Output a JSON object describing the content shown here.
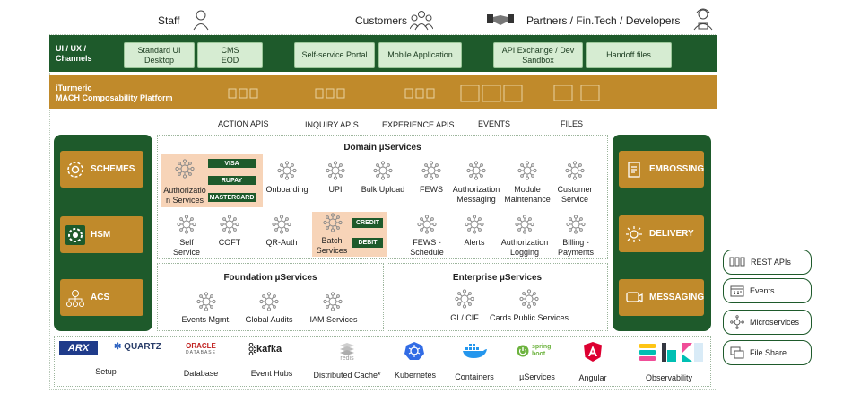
{
  "header": {
    "staff": "Staff",
    "customers": "Customers",
    "partners": "Partners / Fin.Tech / Developers"
  },
  "channels": {
    "title_line1": "UI / UX /",
    "title_line2": "Channels",
    "buttons": [
      {
        "l1": "Standard UI",
        "l2": "Desktop"
      },
      {
        "l1": "CMS",
        "l2": "EOD"
      },
      {
        "l1": "Self-service Portal",
        "l2": ""
      },
      {
        "l1": "Mobile Application",
        "l2": ""
      },
      {
        "l1": "API Exchange / Dev",
        "l2": "Sandbox"
      },
      {
        "l1": "Handoff files",
        "l2": ""
      }
    ]
  },
  "platform": {
    "line1": "iTurmeric",
    "line2": "MACH Composability Platform"
  },
  "apis": [
    "ACTION APIS",
    "INQUIRY APIS",
    "EXPERIENCE APIS",
    "EVENTS",
    "FILES"
  ],
  "left_column": [
    "SCHEMES",
    "HSM",
    "ACS"
  ],
  "right_column": [
    "EMBOSSING",
    "DELIVERY",
    "MESSAGING"
  ],
  "domain": {
    "title": "Domain µServices",
    "auth": {
      "l1": "Authorizatio",
      "l2": "n Services",
      "tags": [
        "VISA",
        "RUPAY",
        "MASTERCARD"
      ]
    },
    "row1": [
      {
        "l1": "Onboarding",
        "l2": ""
      },
      {
        "l1": "UPI",
        "l2": ""
      },
      {
        "l1": "Bulk Upload",
        "l2": ""
      },
      {
        "l1": "FEWS",
        "l2": ""
      },
      {
        "l1": "Authorization",
        "l2": "Messaging"
      },
      {
        "l1": "Module",
        "l2": "Maintenance"
      },
      {
        "l1": "Customer",
        "l2": "Service"
      }
    ],
    "row2a": [
      {
        "l1": "Self",
        "l2": "Service"
      },
      {
        "l1": "COFT",
        "l2": ""
      },
      {
        "l1": "QR-Auth",
        "l2": ""
      }
    ],
    "batch": {
      "l1": "Batch",
      "l2": "Services",
      "tags": [
        "CREDIT",
        "DEBIT"
      ]
    },
    "row2b": [
      {
        "l1": "FEWS -",
        "l2": "Schedule"
      },
      {
        "l1": "Alerts",
        "l2": ""
      },
      {
        "l1": "Authorization",
        "l2": "Logging"
      },
      {
        "l1": "Billing -",
        "l2": "Payments"
      }
    ]
  },
  "foundation": {
    "title": "Foundation µServices",
    "items": [
      "Events Mgmt.",
      "Global Audits",
      "IAM Services"
    ]
  },
  "enterprise": {
    "title": "Enterprise µServices",
    "items": [
      "GL/ CIF",
      "Cards Public Services"
    ]
  },
  "bottom": {
    "setup": "Setup",
    "arx": "ARX",
    "quartz": "QUARTZ",
    "database": "Database",
    "oracle_l1": "ORACLE",
    "oracle_l2": "DATABASE",
    "event_hubs": "Event Hubs",
    "kafka": "kafka",
    "cache": "Distributed Cache*",
    "redis": "redis",
    "kubernetes": "Kubernetes",
    "containers": "Containers",
    "microservices": "µServices",
    "spring_l1": "spring",
    "spring_l2": "boot",
    "angular": "Angular",
    "observability": "Observability"
  },
  "legend": [
    "REST APIs",
    "Events",
    "Microservices",
    "File Share"
  ],
  "colors": {
    "green": "#1e5a2b",
    "gold": "#c08a2b",
    "peach": "#f7d4b8"
  }
}
